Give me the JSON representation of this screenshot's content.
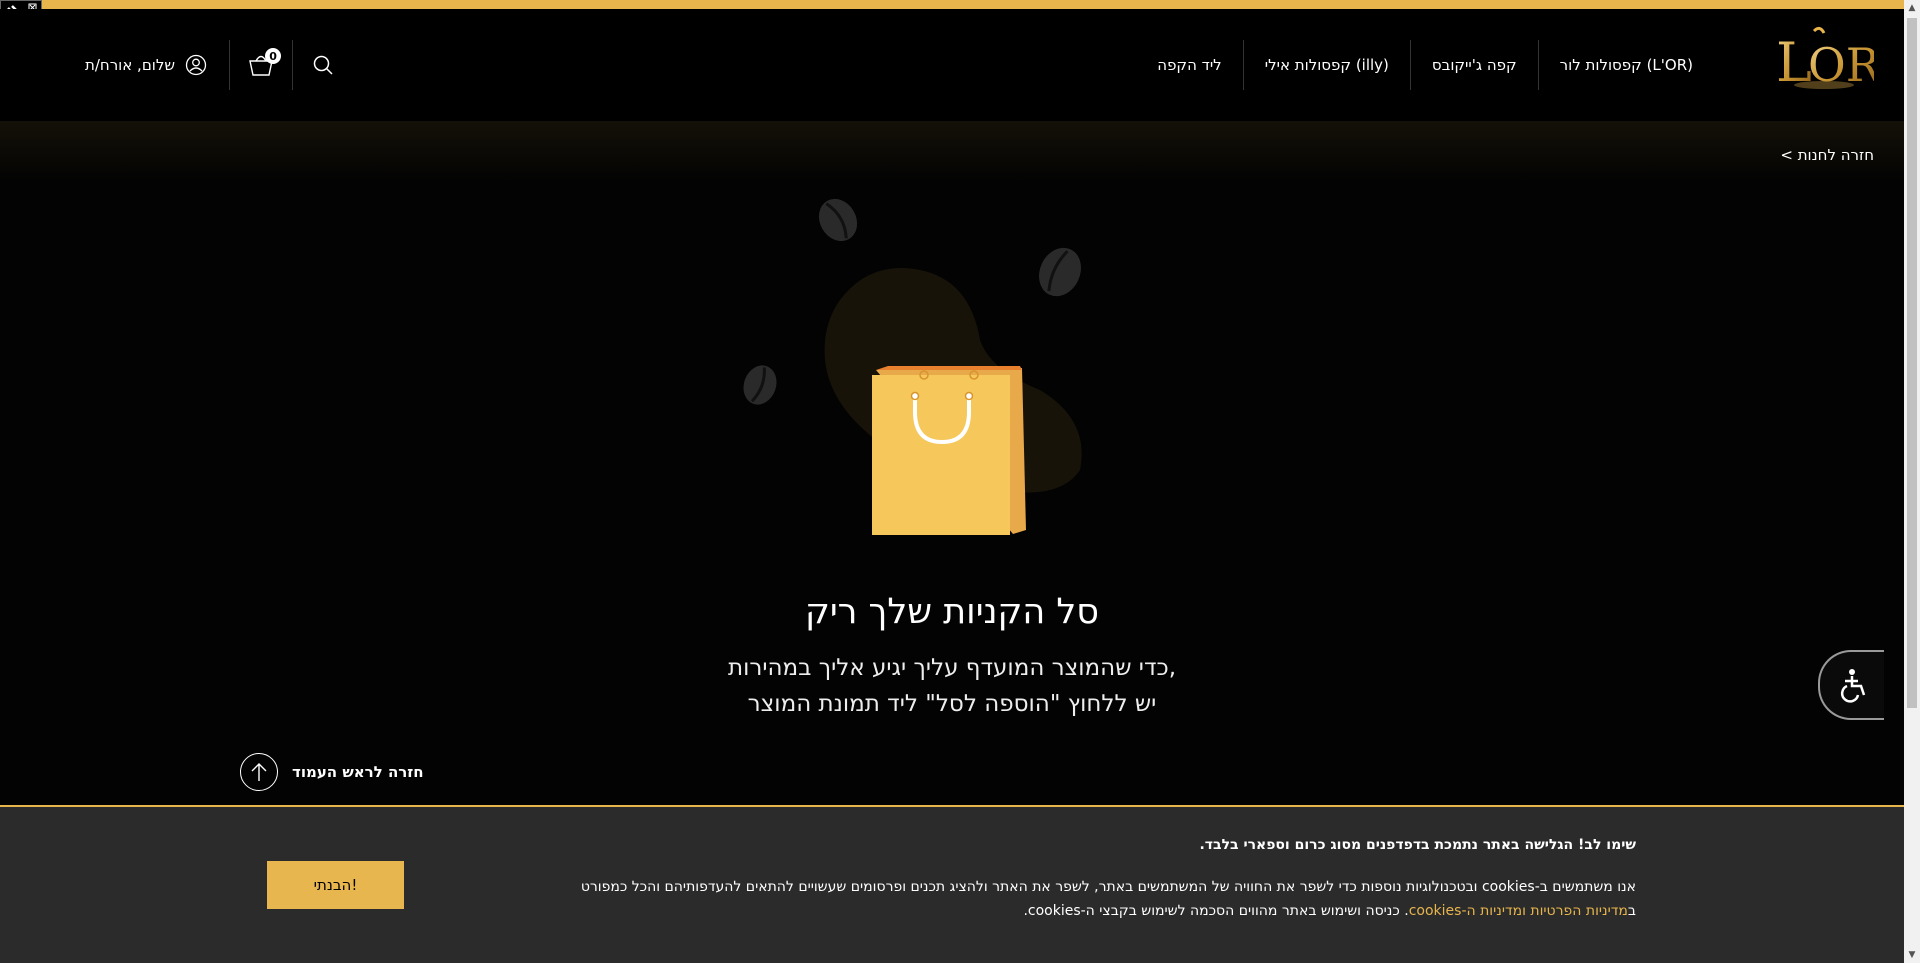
{
  "header": {
    "logo_text": "L'OR",
    "nav": [
      "קפסולות לור (L'OR)",
      "קפה ג'ייקובס",
      "קפסולות אילי (illy)",
      "ליד הקפה"
    ],
    "account_label": "שלום, אורח/ת",
    "cart_count": "0"
  },
  "back_to_store": "< חזרה לחנות",
  "empty_cart": {
    "title": "סל הקניות שלך ריק",
    "line1": "כדי שהמוצר המועדף עליך יגיע אליך במהירות,",
    "line2": "יש ללחוץ \"הוספה לסל\" ליד תמונת המוצר"
  },
  "back_to_top": "חזרה לראש העמוד",
  "cookie": {
    "title": "שימו לב! הגלישה באתר נתמכת בדפדפנים מסוג כרום וספארי בלבד.",
    "text_before": "אנו משתמשים ב-cookies ובטכנולוגיות נוספות כדי לשפר את החוויה של המשתמשים באתר, לשפר את האתר ולהציג תכנים ופרסומים שעשויים להתאים להעדפותיהם והכל כמפורט ב",
    "link": "מדיניות הפרטיות ומדיניות ה-cookies",
    "text_after": ". כניסה ושימוש באתר מהווים הסכמה לשימוש בקבצי ה-cookies.",
    "button": "הבנתי!"
  },
  "colors": {
    "accent": "#e7b54c",
    "background": "#030303",
    "cookie_bg": "#2b2b2b"
  },
  "icons": [
    "user-icon",
    "cart-icon",
    "search-icon",
    "arrow-up-icon",
    "accessibility-icon",
    "shopping-bag-icon",
    "coffee-bean-icon"
  ]
}
